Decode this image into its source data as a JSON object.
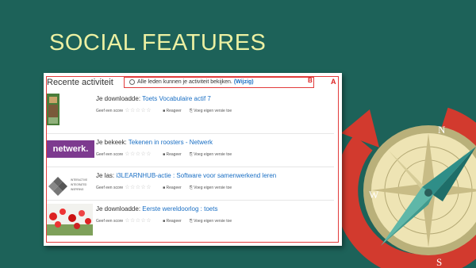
{
  "slide": {
    "title": "SOCIAL FEATURES"
  },
  "panel": {
    "heading": "Recente activiteit",
    "notice_text": "Alle leden kunnen je activiteit bekijken.",
    "notice_link": "(Wijzig)",
    "label_a": "A",
    "label_b": "B",
    "items": [
      {
        "prefix": "Je downloadde:",
        "link": "Toets Vocabulaire actif 7",
        "rate": "Geef een score",
        "reply": "Reageer",
        "version": "Voeg eigen versie toe",
        "thumb": "book-cover"
      },
      {
        "prefix": "Je bekeek:",
        "link": "Tekenen in roosters - Netwerk",
        "rate": "Geef een score",
        "reply": "Reageer",
        "version": "Voeg eigen versie toe",
        "thumb": "netwerk-logo",
        "thumb_text": "netwerk."
      },
      {
        "prefix": "Je las:",
        "link": "i3LEARNHUB-actie : Software voor samenwerkend leren",
        "rate": "Geef een score",
        "reply": "Reageer",
        "version": "Voeg eigen versie toe",
        "thumb": "iii-logo",
        "thumb_text": [
          "INTERACTIVE",
          "INTEGRATED",
          "INSPIRING"
        ]
      },
      {
        "prefix": "Je downloadde:",
        "link": "Eerste wereldoorlog : toets",
        "rate": "Geef een score",
        "reply": "Reageer",
        "version": "Voeg eigen versie toe",
        "thumb": "poppies-photo"
      }
    ]
  },
  "compass": {
    "n": "N",
    "w": "W",
    "s": "S"
  },
  "colors": {
    "background": "#1d6259",
    "title": "#ecf0a2",
    "link": "#1a6fc4",
    "accent": "#e23c3c"
  }
}
